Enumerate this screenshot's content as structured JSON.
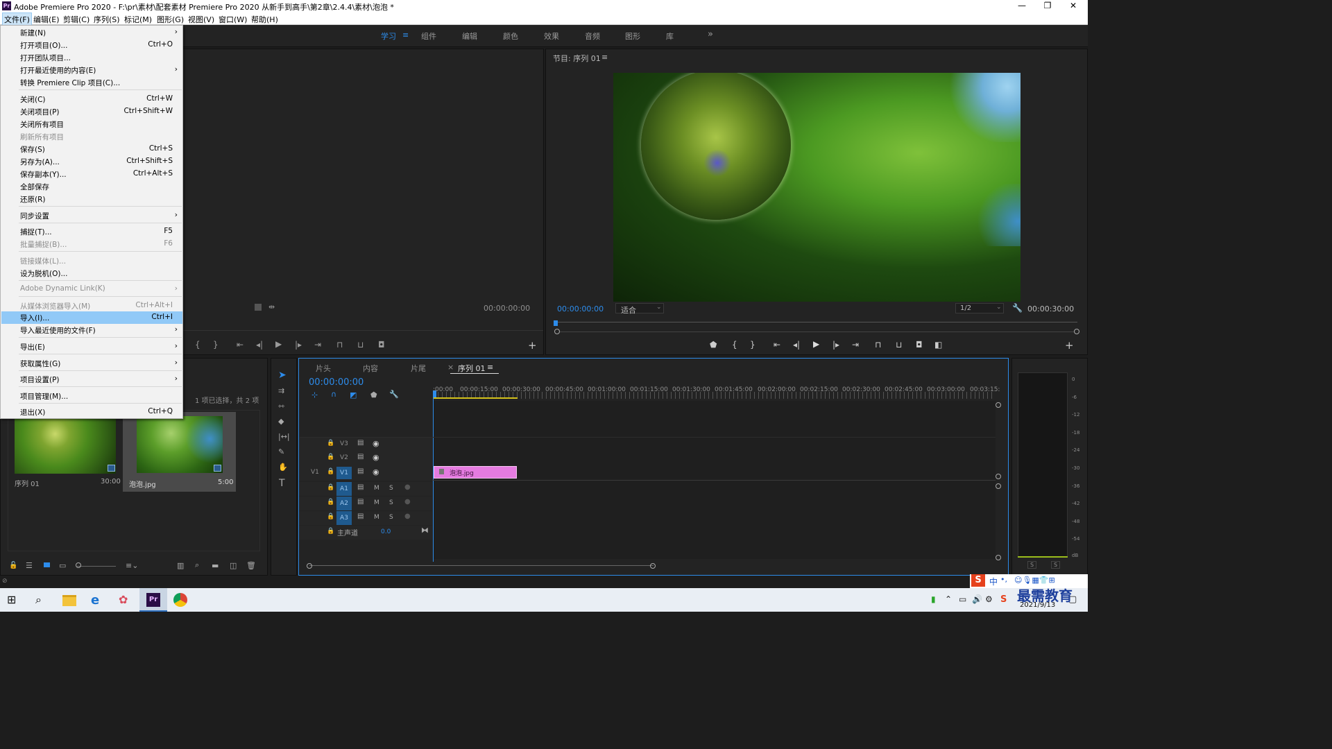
{
  "window": {
    "title": "Adobe Premiere Pro 2020 - F:\\pr\\素材\\配套素材 Premiere Pro 2020 从新手到高手\\第2章\\2.4.4\\素材\\泡泡 *",
    "logo": "Pr",
    "minimize": "—",
    "maximize": "❐",
    "close": "✕"
  },
  "menubar": {
    "items": [
      "文件(F)",
      "编辑(E)",
      "剪辑(C)",
      "序列(S)",
      "标记(M)",
      "图形(G)",
      "视图(V)",
      "窗口(W)",
      "帮助(H)"
    ]
  },
  "workspaces": {
    "items": [
      "学习",
      "组件",
      "编辑",
      "颜色",
      "效果",
      "音频",
      "图形",
      "库"
    ],
    "active": "学习",
    "more": "»",
    "menu": "≡"
  },
  "file_menu": {
    "items": [
      {
        "label": "新建(N)",
        "shortcut": "",
        "submenu": true,
        "disabled": false
      },
      {
        "label": "打开项目(O)...",
        "shortcut": "Ctrl+O",
        "submenu": false,
        "disabled": false
      },
      {
        "label": "打开团队项目...",
        "shortcut": "",
        "submenu": false,
        "disabled": false
      },
      {
        "label": "打开最近使用的内容(E)",
        "shortcut": "",
        "submenu": true,
        "disabled": false
      },
      {
        "label": "转换 Premiere Clip 项目(C)...",
        "shortcut": "",
        "submenu": false,
        "disabled": false
      },
      {
        "label": "关闭(C)",
        "shortcut": "Ctrl+W",
        "submenu": false,
        "disabled": false
      },
      {
        "label": "关闭项目(P)",
        "shortcut": "Ctrl+Shift+W",
        "submenu": false,
        "disabled": false
      },
      {
        "label": "关闭所有项目",
        "shortcut": "",
        "submenu": false,
        "disabled": false
      },
      {
        "label": "刷新所有项目",
        "shortcut": "",
        "submenu": false,
        "disabled": true
      },
      {
        "label": "保存(S)",
        "shortcut": "Ctrl+S",
        "submenu": false,
        "disabled": false
      },
      {
        "label": "另存为(A)...",
        "shortcut": "Ctrl+Shift+S",
        "submenu": false,
        "disabled": false
      },
      {
        "label": "保存副本(Y)...",
        "shortcut": "Ctrl+Alt+S",
        "submenu": false,
        "disabled": false
      },
      {
        "label": "全部保存",
        "shortcut": "",
        "submenu": false,
        "disabled": false
      },
      {
        "label": "还原(R)",
        "shortcut": "",
        "submenu": false,
        "disabled": false
      },
      {
        "label": "同步设置",
        "shortcut": "",
        "submenu": true,
        "disabled": false
      },
      {
        "label": "捕捉(T)...",
        "shortcut": "F5",
        "submenu": false,
        "disabled": false
      },
      {
        "label": "批量捕捉(B)...",
        "shortcut": "F6",
        "submenu": false,
        "disabled": true
      },
      {
        "label": "链接媒体(L)...",
        "shortcut": "",
        "submenu": false,
        "disabled": true
      },
      {
        "label": "设为脱机(O)...",
        "shortcut": "",
        "submenu": false,
        "disabled": false
      },
      {
        "label": "Adobe Dynamic Link(K)",
        "shortcut": "",
        "submenu": true,
        "disabled": true
      },
      {
        "label": "从媒体浏览器导入(M)",
        "shortcut": "Ctrl+Alt+I",
        "submenu": false,
        "disabled": true
      },
      {
        "label": "导入(I)...",
        "shortcut": "Ctrl+I",
        "submenu": false,
        "disabled": false,
        "highlighted": true
      },
      {
        "label": "导入最近使用的文件(F)",
        "shortcut": "",
        "submenu": true,
        "disabled": false
      },
      {
        "label": "导出(E)",
        "shortcut": "",
        "submenu": true,
        "disabled": false
      },
      {
        "label": "获取属性(G)",
        "shortcut": "",
        "submenu": true,
        "disabled": false
      },
      {
        "label": "项目设置(P)",
        "shortcut": "",
        "submenu": true,
        "disabled": false
      },
      {
        "label": "项目管理(M)...",
        "shortcut": "",
        "submenu": false,
        "disabled": false
      },
      {
        "label": "退出(X)",
        "shortcut": "Ctrl+Q",
        "submenu": false,
        "disabled": false
      }
    ]
  },
  "source_monitor": {
    "timecode": "00:00:00:00"
  },
  "program_monitor": {
    "title": "节目: 序列 01",
    "menu": "≡",
    "timecode": "00:00:00:00",
    "fit": "适合",
    "resolution": "1/2",
    "duration": "00:00:30:00"
  },
  "project_panel": {
    "selection_status": "1 项已选择，共 2 项",
    "items": [
      {
        "name": "序列 01",
        "duration": "30:00"
      },
      {
        "name": "泡泡.jpg",
        "duration": "5:00"
      }
    ]
  },
  "timeline": {
    "tabs": [
      "片头",
      "内容",
      "片尾",
      "序列 01"
    ],
    "active_tab": "序列 01",
    "close": "×",
    "menu": "≡",
    "timecode": "00:00:00:00",
    "ruler": [
      ":00:00",
      "00:00:15:00",
      "00:00:30:00",
      "00:00:45:00",
      "00:01:00:00",
      "00:01:15:00",
      "00:01:30:00",
      "00:01:45:00",
      "00:02:00:00",
      "00:02:15:00",
      "00:02:30:00",
      "00:02:45:00",
      "00:03:00:00",
      "00:03:15:"
    ],
    "video_tracks": [
      "V3",
      "V2",
      "V1"
    ],
    "source_patch": "V1",
    "audio_tracks": [
      "A1",
      "A2",
      "A3"
    ],
    "mute": "M",
    "solo": "S",
    "master_label": "主声道",
    "master_value": "0.0",
    "clip": {
      "name": "泡泡.jpg",
      "color": "#e57be0"
    }
  },
  "audio_meter": {
    "scale": [
      "0",
      "-6",
      "-12",
      "-18",
      "-24",
      "-30",
      "-36",
      "-42",
      "-48",
      "-54",
      "dB"
    ],
    "solo_left": "S",
    "solo_right": "S"
  },
  "ime": {
    "label": "中",
    "dot": "•,",
    "watermark": "最需教育"
  },
  "taskbar": {
    "date": "2021/9/13"
  },
  "colors": {
    "accent": "#2d8ceb",
    "panel": "#232323",
    "menu_highlight": "#91c9f7",
    "clip_pink": "#e57be0"
  }
}
